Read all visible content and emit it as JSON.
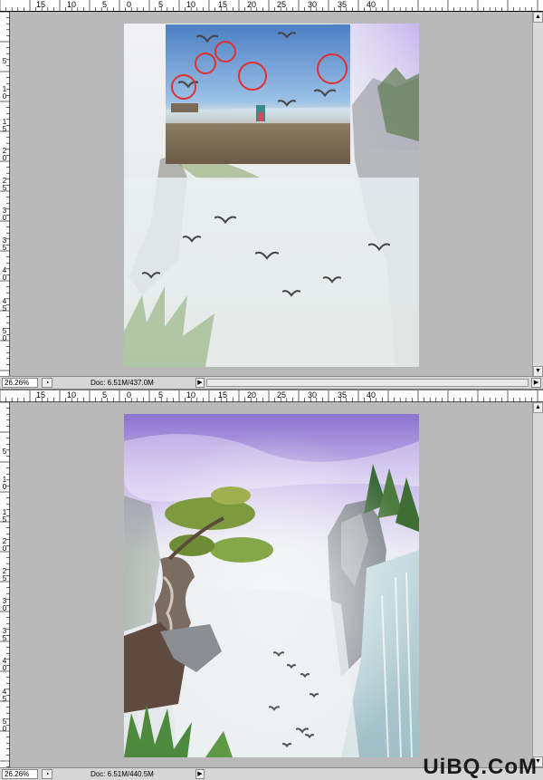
{
  "top_window": {
    "ruler_h": [
      "15",
      "10",
      "5",
      "0",
      "5",
      "10",
      "15",
      "20",
      "25",
      "30",
      "35",
      "40"
    ],
    "ruler_v": [
      "5",
      "1 0",
      "1 5",
      "2 0",
      "2 5",
      "3 0",
      "3 5",
      "4 0",
      "4 5",
      "5 0"
    ],
    "zoom": "26.26%",
    "doc_info": "Doc: 6.51M/437.0M",
    "nav_arrow": "▶",
    "scroll_up": "▲",
    "scroll_down": "▼"
  },
  "bottom_window": {
    "ruler_h": [
      "15",
      "10",
      "5",
      "0",
      "5",
      "10",
      "15",
      "20",
      "25",
      "30",
      "35",
      "40"
    ],
    "ruler_v": [
      "5",
      "1 0",
      "1 5",
      "2 0",
      "2 5",
      "3 0",
      "3 5",
      "4 0",
      "4 5",
      "5 0"
    ],
    "zoom": "26.26%",
    "doc_info": "Doc: 6.51M/440.5M",
    "nav_arrow": "▶",
    "scroll_up": "▲",
    "scroll_down": "▼"
  },
  "watermark": {
    "text": "UiBQ.CoM"
  },
  "colors": {
    "workspace": "#b9b9b9",
    "ruler": "#ffffff",
    "statusbar": "#d6d6d6",
    "highlight_circle": "#e03030",
    "sky_purple": "#9a80d8",
    "mist": "#dfe6ea"
  },
  "icons": [
    "status-menu-icon",
    "nav-arrow-icon",
    "scroll-up-icon",
    "scroll-down-icon",
    "seagull-icon",
    "highlight-circle-icon"
  ]
}
